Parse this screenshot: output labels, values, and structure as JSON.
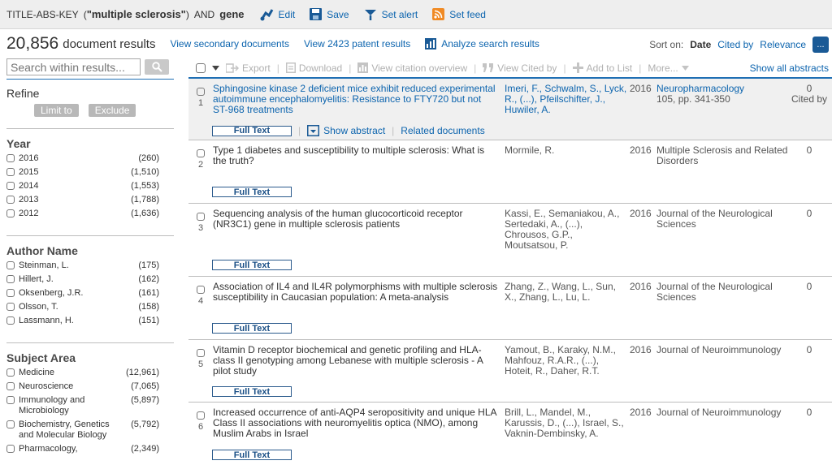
{
  "query": {
    "field": "TITLE-ABS-KEY",
    "open_paren": "(",
    "phrase": "\"multiple sclerosis\"",
    "close_paren": ")",
    "operator": "AND",
    "term": "gene",
    "actions": [
      {
        "label": "Edit",
        "icon": "edit-icon"
      },
      {
        "label": "Save",
        "icon": "save-icon"
      },
      {
        "label": "Set alert",
        "icon": "alert-icon"
      },
      {
        "label": "Set feed",
        "icon": "rss-icon"
      }
    ]
  },
  "results_header": {
    "count": "20,856",
    "count_label": "document results",
    "secondary_link": "View secondary documents",
    "patent_link": "View 2423 patent results",
    "analyze_link": "Analyze search results",
    "sort_label": "Sort on:",
    "sort_options": [
      "Date",
      "Cited by",
      "Relevance"
    ],
    "sort_active": "Date",
    "more_label": "..."
  },
  "sidebar": {
    "search_placeholder": "Search within results...",
    "refine_title": "Refine",
    "limit_label": "Limit to",
    "exclude_label": "Exclude",
    "facets": [
      {
        "title": "Year",
        "items": [
          {
            "label": "2016",
            "count": "(260)"
          },
          {
            "label": "2015",
            "count": "(1,510)"
          },
          {
            "label": "2014",
            "count": "(1,553)"
          },
          {
            "label": "2013",
            "count": "(1,788)"
          },
          {
            "label": "2012",
            "count": "(1,636)"
          }
        ]
      },
      {
        "title": "Author Name",
        "items": [
          {
            "label": "Steinman, L.",
            "count": "(175)"
          },
          {
            "label": "Hillert, J.",
            "count": "(162)"
          },
          {
            "label": "Oksenberg, J.R.",
            "count": "(161)"
          },
          {
            "label": "Olsson, T.",
            "count": "(158)"
          },
          {
            "label": "Lassmann, H.",
            "count": "(151)"
          }
        ]
      },
      {
        "title": "Subject Area",
        "items": [
          {
            "label": "Medicine",
            "count": "(12,961)"
          },
          {
            "label": "Neuroscience",
            "count": "(7,065)"
          },
          {
            "label": "Immunology and Microbiology",
            "count": "(5,897)"
          },
          {
            "label": "Biochemistry, Genetics and Molecular Biology",
            "count": "(5,792)"
          },
          {
            "label": "Pharmacology,",
            "count": "(2,349)"
          }
        ]
      }
    ]
  },
  "toolbar": {
    "export": "Export",
    "download": "Download",
    "citation_overview": "View citation overview",
    "cited_by": "View Cited by",
    "add_to_list": "Add to List",
    "more": "More...",
    "show_all_abstracts": "Show all abstracts"
  },
  "row_actions": {
    "full_text": "Full Text",
    "show_abstract": "Show abstract",
    "related": "Related documents"
  },
  "results": [
    {
      "num": "1",
      "title": "Sphingosine kinase 2 deficient mice exhibit reduced experimental autoimmune encephalomyelitis: Resistance to FTY720 but not ST-968 treatments",
      "authors": "Imeri, F., Schwalm, S., Lyck, R., (...), Pfeilschifter, J., Huwiler, A.",
      "year": "2016",
      "source": "Neuropharmacology",
      "volume": "105, pp. 341-350",
      "cited": "0",
      "cited_label": "Cited by"
    },
    {
      "num": "2",
      "title": "Type 1 diabetes and susceptibility to multiple sclerosis: What is the truth?",
      "authors": "Mormile, R.",
      "year": "2016",
      "source": "Multiple Sclerosis and Related Disorders",
      "cited": "0"
    },
    {
      "num": "3",
      "title": "Sequencing analysis of the human glucocorticoid receptor (NR3C1) gene in multiple sclerosis patients",
      "authors": "Kassi, E., Semaniakou, A., Sertedaki, A., (...), Chrousos, G.P., Moutsatsou, P.",
      "year": "2016",
      "source": "Journal of the Neurological Sciences",
      "cited": "0"
    },
    {
      "num": "4",
      "title": "Association of IL4 and IL4R polymorphisms with multiple sclerosis susceptibility in Caucasian population: A meta-analysis",
      "authors": "Zhang, Z., Wang, L., Sun, X., Zhang, L., Lu, L.",
      "year": "2016",
      "source": "Journal of the Neurological Sciences",
      "cited": "0"
    },
    {
      "num": "5",
      "title": "Vitamin D receptor biochemical and genetic profiling and HLA-class II genotyping among Lebanese with multiple sclerosis - A pilot study",
      "authors": "Yamout, B., Karaky, N.M., Mahfouz, R.A.R., (...), Hoteit, R., Daher, R.T.",
      "year": "2016",
      "source": "Journal of Neuroimmunology",
      "cited": "0"
    },
    {
      "num": "6",
      "title": "Increased occurrence of anti-AQP4 seropositivity and unique HLA Class II associations with neuromyelitis optica (NMO), among Muslim Arabs in Israel",
      "authors": "Brill, L., Mandel, M., Karussis, D., (...), Israel, S., Vaknin-Dembinsky, A.",
      "year": "2016",
      "source": "Journal of Neuroimmunology",
      "cited": "0"
    }
  ]
}
